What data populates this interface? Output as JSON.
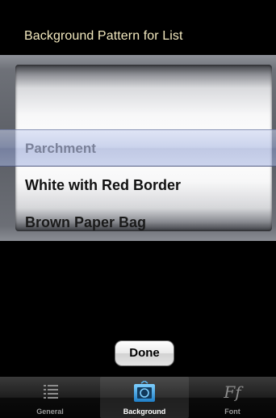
{
  "header": {
    "title": "Background Pattern for List"
  },
  "picker": {
    "rows": [
      "Parchment",
      "White with Red Border",
      "Brown Paper Bag"
    ]
  },
  "done_button": {
    "label": "Done"
  },
  "tab_bar": {
    "tabs": [
      {
        "label": "General",
        "icon": "list-icon",
        "selected": false
      },
      {
        "label": "Background",
        "icon": "picture-frame-icon",
        "selected": true
      },
      {
        "label": "Font",
        "icon": "font-icon",
        "icon_text": "Ff",
        "selected": false
      }
    ]
  },
  "colors": {
    "title": "#f3e9bf",
    "selected_tab_icon": "#3aa0e6"
  }
}
